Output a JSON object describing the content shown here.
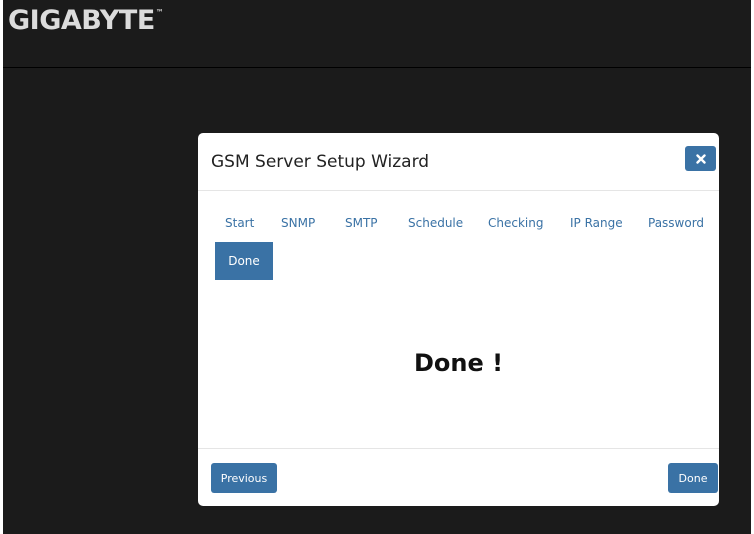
{
  "header": {
    "brand": "GIGABYTE",
    "trademark": "™"
  },
  "wizard": {
    "title": "GSM Server Setup Wizard",
    "close_icon": "close-icon",
    "steps": [
      {
        "label": "Start"
      },
      {
        "label": "SNMP"
      },
      {
        "label": "SMTP"
      },
      {
        "label": "Schedule"
      },
      {
        "label": "Checking"
      },
      {
        "label": "IP Range"
      },
      {
        "label": "Password"
      },
      {
        "label": "Done",
        "active": true
      }
    ],
    "message": "Done !",
    "previous_label": "Previous",
    "done_label": "Done"
  },
  "colors": {
    "accent": "#3a72a5",
    "background": "#1b1b1b",
    "modal": "#ffffff"
  }
}
